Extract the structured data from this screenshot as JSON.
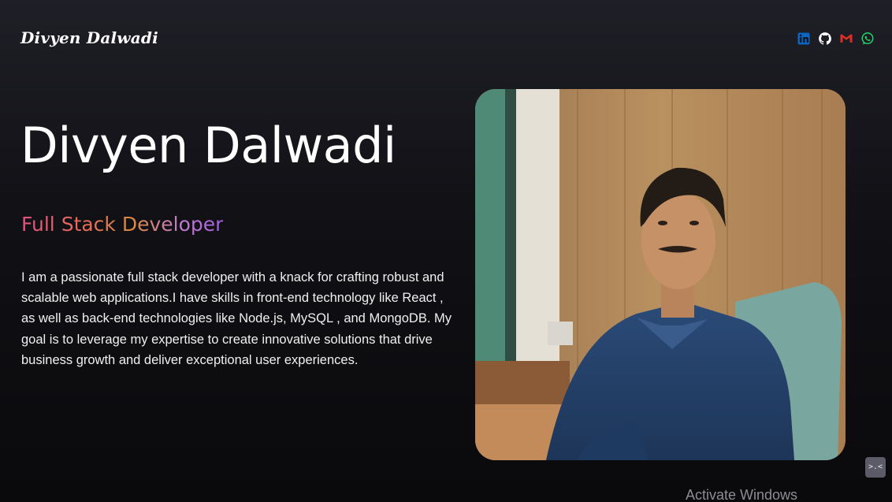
{
  "header": {
    "logo_text": "Divyen Dalwadi",
    "social_links": [
      {
        "name": "linkedin-icon",
        "color": "#0a66c2"
      },
      {
        "name": "github-icon",
        "color": "#ffffff"
      },
      {
        "name": "gmail-icon",
        "color": "#d93025"
      },
      {
        "name": "whatsapp-icon",
        "color": "#25d366"
      }
    ]
  },
  "hero": {
    "name": "Divyen Dalwadi",
    "role": "Full Stack Developer",
    "bio": "I am a passionate full stack developer with a knack for crafting robust and scalable web applications.I have skills in front-end technology like React , as well as back-end technologies like Node.js, MySQL , and MongoDB. My goal is to leverage my expertise to create innovative solutions that drive business growth and deliver exceptional user experiences."
  },
  "overlay": {
    "watermark": "Activate Windows",
    "corner_button_glyph": ">.<"
  },
  "colors": {
    "background": "#111116",
    "role_gradient": [
      "#e0527f",
      "#d98a3e",
      "#a35ee0"
    ]
  }
}
